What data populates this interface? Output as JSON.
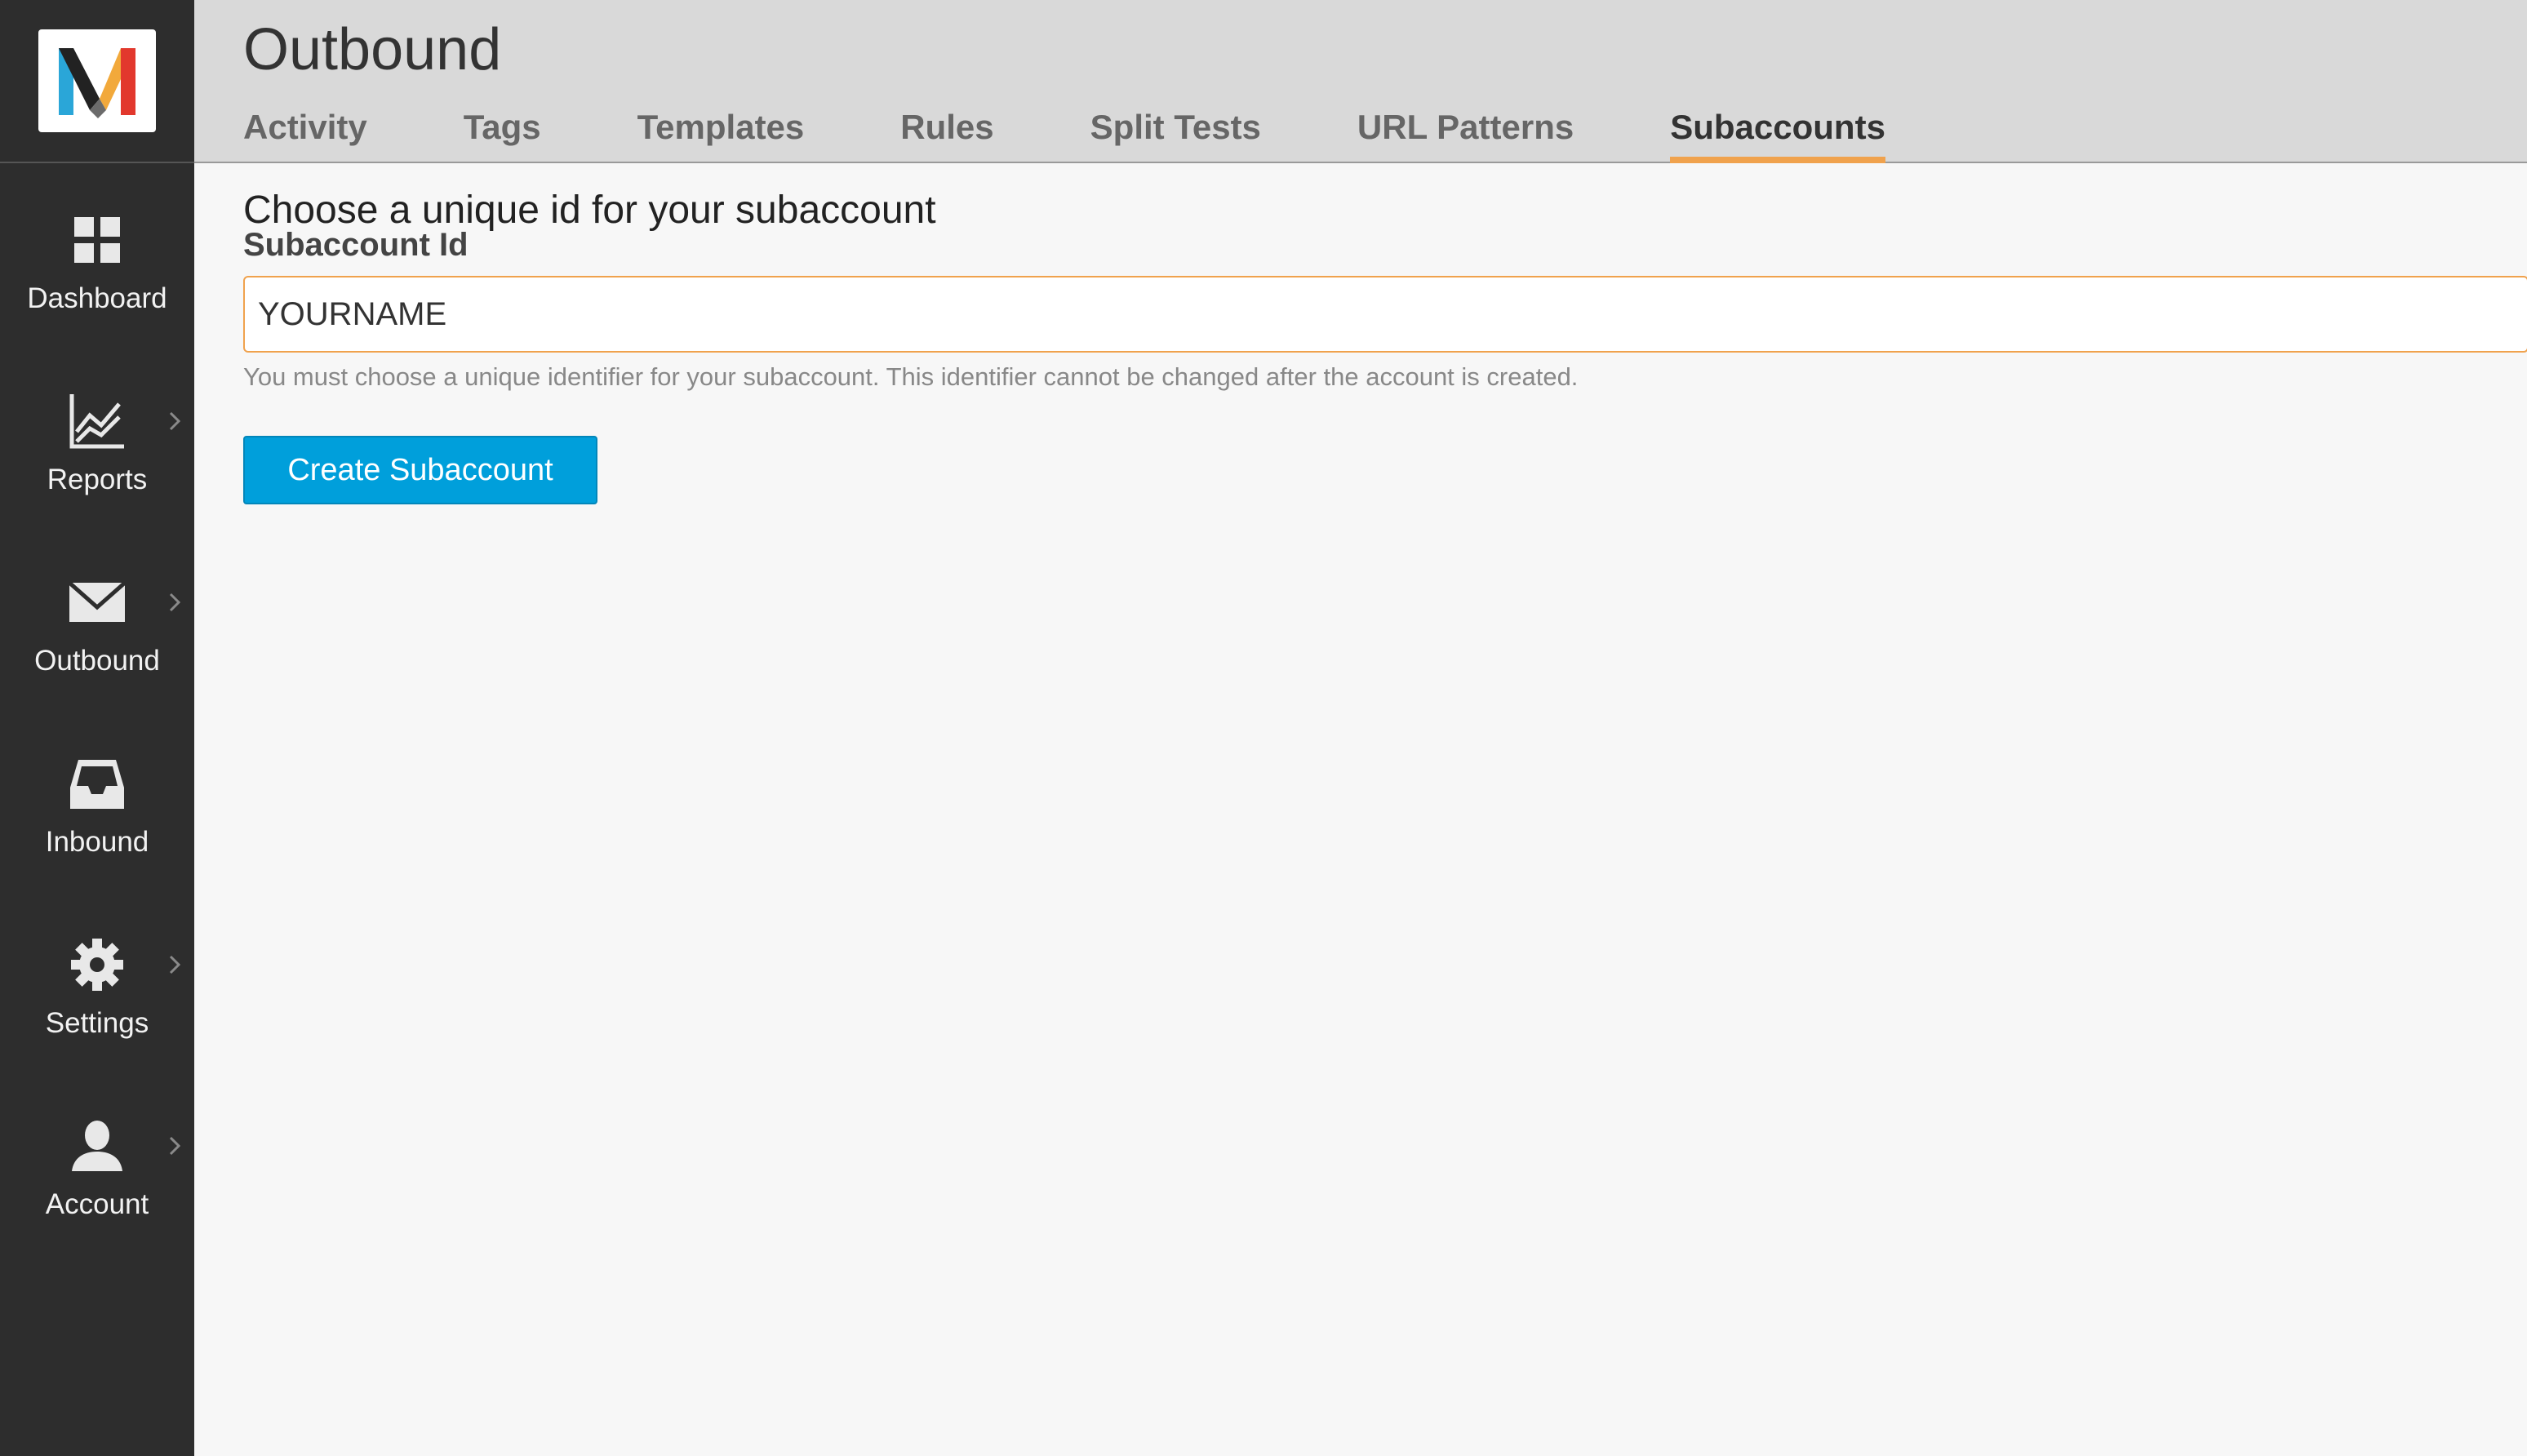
{
  "colors": {
    "sidebar_bg": "#2d2d2d",
    "header_bg": "#d9d9d9",
    "accent": "#f0a24d",
    "button_bg": "#009fdb"
  },
  "sidebar": {
    "items": [
      {
        "label": "Dashboard",
        "icon": "grid-icon",
        "has_submenu": false
      },
      {
        "label": "Reports",
        "icon": "chart-icon",
        "has_submenu": true
      },
      {
        "label": "Outbound",
        "icon": "envelope-icon",
        "has_submenu": true
      },
      {
        "label": "Inbound",
        "icon": "inbox-icon",
        "has_submenu": false
      },
      {
        "label": "Settings",
        "icon": "gear-icon",
        "has_submenu": true
      },
      {
        "label": "Account",
        "icon": "user-icon",
        "has_submenu": true
      }
    ]
  },
  "header": {
    "title": "Outbound",
    "tabs": [
      {
        "label": "Activity",
        "active": false
      },
      {
        "label": "Tags",
        "active": false
      },
      {
        "label": "Templates",
        "active": false
      },
      {
        "label": "Rules",
        "active": false
      },
      {
        "label": "Split Tests",
        "active": false
      },
      {
        "label": "URL Patterns",
        "active": false
      },
      {
        "label": "Subaccounts",
        "active": true
      }
    ]
  },
  "form": {
    "heading": "Choose a unique id for your subaccount",
    "field_label": "Subaccount Id",
    "input_value": "YOURNAME",
    "help_text": "You must choose a unique identifier for your subaccount. This identifier cannot be changed after the account is created.",
    "submit_label": "Create Subaccount"
  }
}
